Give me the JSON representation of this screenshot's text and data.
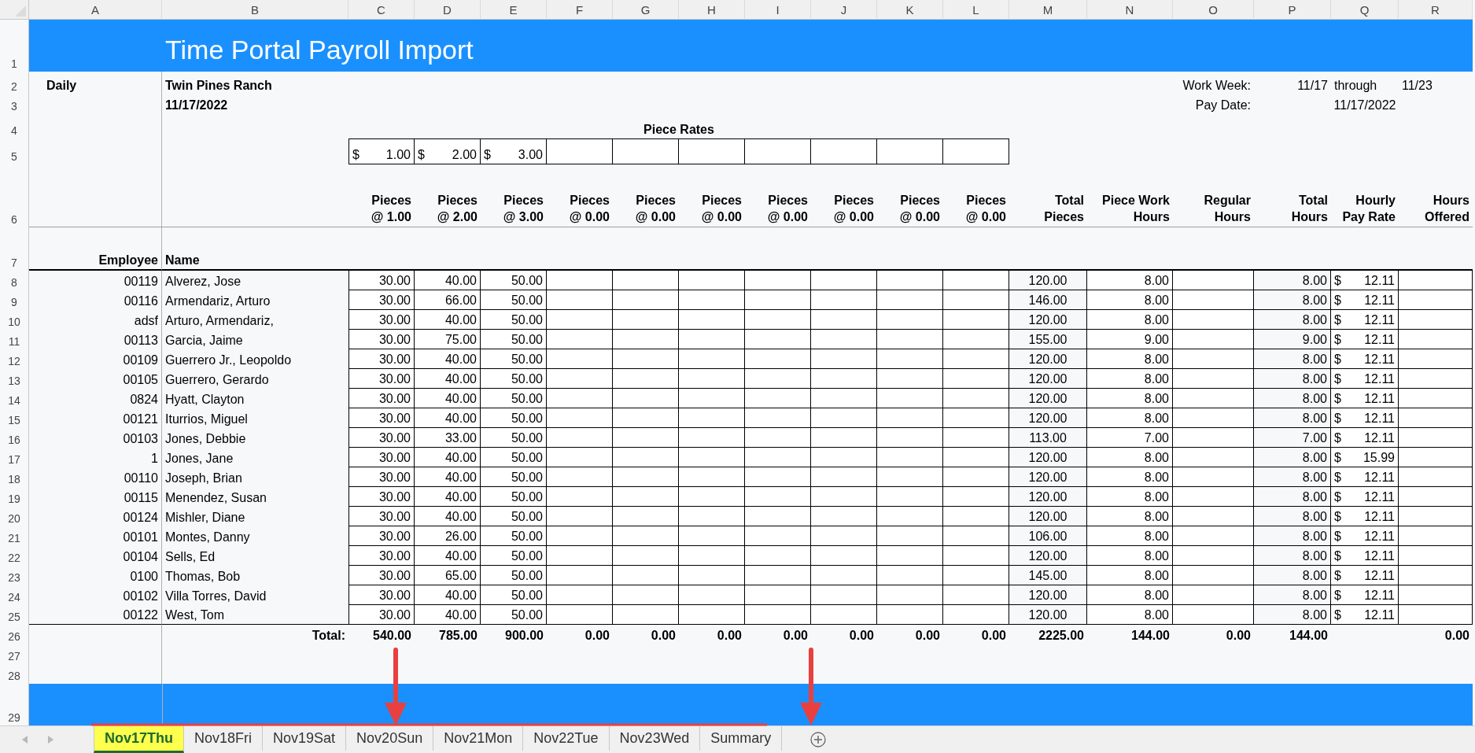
{
  "column_letters": [
    "A",
    "B",
    "C",
    "D",
    "E",
    "F",
    "G",
    "H",
    "I",
    "J",
    "K",
    "L",
    "M",
    "N",
    "O",
    "P",
    "Q",
    "R"
  ],
  "row_numbers": [
    "1",
    "2",
    "3",
    "4",
    "5",
    "6",
    "7",
    "8",
    "9",
    "10",
    "11",
    "12",
    "13",
    "14",
    "15",
    "16",
    "17",
    "18",
    "19",
    "20",
    "21",
    "22",
    "23",
    "24",
    "25",
    "26",
    "27",
    "28",
    "29"
  ],
  "title": "Time Portal Payroll Import",
  "report_type": "Daily",
  "company": "Twin Pines Ranch",
  "report_date": "11/17/2022",
  "work_week": {
    "label": "Work Week:",
    "start": "11/17",
    "through": "through",
    "end": "11/23"
  },
  "pay_date": {
    "label": "Pay Date:",
    "value": "11/17/2022"
  },
  "piece_rates": {
    "title": "Piece Rates",
    "rates": [
      {
        "currency": "$",
        "amount": "1.00"
      },
      {
        "currency": "$",
        "amount": "2.00"
      },
      {
        "currency": "$",
        "amount": "3.00"
      }
    ]
  },
  "column_headings": [
    {
      "lines": [
        "Pieces",
        "@ 1.00"
      ]
    },
    {
      "lines": [
        "Pieces",
        "@ 2.00"
      ]
    },
    {
      "lines": [
        "Pieces",
        "@ 3.00"
      ]
    },
    {
      "lines": [
        "Pieces",
        "@ 0.00"
      ]
    },
    {
      "lines": [
        "Pieces",
        "@ 0.00"
      ]
    },
    {
      "lines": [
        "Pieces",
        "@ 0.00"
      ]
    },
    {
      "lines": [
        "Pieces",
        "@ 0.00"
      ]
    },
    {
      "lines": [
        "Pieces",
        "@ 0.00"
      ]
    },
    {
      "lines": [
        "Pieces",
        "@ 0.00"
      ]
    },
    {
      "lines": [
        "Pieces",
        "@ 0.00"
      ]
    },
    {
      "lines": [
        "Total",
        "Pieces"
      ]
    },
    {
      "lines": [
        "Piece Work",
        "Hours"
      ]
    },
    {
      "lines": [
        "Regular",
        "Hours"
      ]
    },
    {
      "lines": [
        "Total",
        "Hours"
      ]
    },
    {
      "lines": [
        "Hourly",
        "Pay Rate"
      ]
    },
    {
      "lines": [
        "Hours",
        "Offered"
      ]
    }
  ],
  "employee_heading": "Employee",
  "name_heading": "Name",
  "rows": [
    {
      "employee": "00119",
      "name": "Alverez, Jose",
      "pieces": [
        "30.00",
        "40.00",
        "50.00"
      ],
      "total_pieces": "120.00",
      "piece_work_hours": "8.00",
      "total_hours": "8.00",
      "pay_rate": {
        "currency": "$",
        "amount": "12.11"
      }
    },
    {
      "employee": "00116",
      "name": "Armendariz, Arturo",
      "pieces": [
        "30.00",
        "66.00",
        "50.00"
      ],
      "total_pieces": "146.00",
      "piece_work_hours": "8.00",
      "total_hours": "8.00",
      "pay_rate": {
        "currency": "$",
        "amount": "12.11"
      }
    },
    {
      "employee": "adsf",
      "name": "Arturo, Armendariz,",
      "pieces": [
        "30.00",
        "40.00",
        "50.00"
      ],
      "total_pieces": "120.00",
      "piece_work_hours": "8.00",
      "total_hours": "8.00",
      "pay_rate": {
        "currency": "$",
        "amount": "12.11"
      }
    },
    {
      "employee": "00113",
      "name": "Garcia, Jaime",
      "pieces": [
        "30.00",
        "75.00",
        "50.00"
      ],
      "total_pieces": "155.00",
      "piece_work_hours": "9.00",
      "total_hours": "9.00",
      "pay_rate": {
        "currency": "$",
        "amount": "12.11"
      }
    },
    {
      "employee": "00109",
      "name": "Guerrero Jr., Leopoldo",
      "pieces": [
        "30.00",
        "40.00",
        "50.00"
      ],
      "total_pieces": "120.00",
      "piece_work_hours": "8.00",
      "total_hours": "8.00",
      "pay_rate": {
        "currency": "$",
        "amount": "12.11"
      }
    },
    {
      "employee": "00105",
      "name": "Guerrero, Gerardo",
      "pieces": [
        "30.00",
        "40.00",
        "50.00"
      ],
      "total_pieces": "120.00",
      "piece_work_hours": "8.00",
      "total_hours": "8.00",
      "pay_rate": {
        "currency": "$",
        "amount": "12.11"
      }
    },
    {
      "employee": "0824",
      "name": "Hyatt, Clayton",
      "pieces": [
        "30.00",
        "40.00",
        "50.00"
      ],
      "total_pieces": "120.00",
      "piece_work_hours": "8.00",
      "total_hours": "8.00",
      "pay_rate": {
        "currency": "$",
        "amount": "12.11"
      }
    },
    {
      "employee": "00121",
      "name": "Iturrios, Miguel",
      "pieces": [
        "30.00",
        "40.00",
        "50.00"
      ],
      "total_pieces": "120.00",
      "piece_work_hours": "8.00",
      "total_hours": "8.00",
      "pay_rate": {
        "currency": "$",
        "amount": "12.11"
      }
    },
    {
      "employee": "00103",
      "name": "Jones, Debbie",
      "pieces": [
        "30.00",
        "33.00",
        "50.00"
      ],
      "total_pieces": "113.00",
      "piece_work_hours": "7.00",
      "total_hours": "7.00",
      "pay_rate": {
        "currency": "$",
        "amount": "12.11"
      }
    },
    {
      "employee": "1",
      "name": "Jones, Jane",
      "pieces": [
        "30.00",
        "40.00",
        "50.00"
      ],
      "total_pieces": "120.00",
      "piece_work_hours": "8.00",
      "total_hours": "8.00",
      "pay_rate": {
        "currency": "$",
        "amount": "15.99"
      }
    },
    {
      "employee": "00110",
      "name": "Joseph, Brian",
      "pieces": [
        "30.00",
        "40.00",
        "50.00"
      ],
      "total_pieces": "120.00",
      "piece_work_hours": "8.00",
      "total_hours": "8.00",
      "pay_rate": {
        "currency": "$",
        "amount": "12.11"
      }
    },
    {
      "employee": "00115",
      "name": "Menendez, Susan",
      "pieces": [
        "30.00",
        "40.00",
        "50.00"
      ],
      "total_pieces": "120.00",
      "piece_work_hours": "8.00",
      "total_hours": "8.00",
      "pay_rate": {
        "currency": "$",
        "amount": "12.11"
      }
    },
    {
      "employee": "00124",
      "name": "Mishler, Diane",
      "pieces": [
        "30.00",
        "40.00",
        "50.00"
      ],
      "total_pieces": "120.00",
      "piece_work_hours": "8.00",
      "total_hours": "8.00",
      "pay_rate": {
        "currency": "$",
        "amount": "12.11"
      }
    },
    {
      "employee": "00101",
      "name": "Montes, Danny",
      "pieces": [
        "30.00",
        "26.00",
        "50.00"
      ],
      "total_pieces": "106.00",
      "piece_work_hours": "8.00",
      "total_hours": "8.00",
      "pay_rate": {
        "currency": "$",
        "amount": "12.11"
      }
    },
    {
      "employee": "00104",
      "name": "Sells, Ed",
      "pieces": [
        "30.00",
        "40.00",
        "50.00"
      ],
      "total_pieces": "120.00",
      "piece_work_hours": "8.00",
      "total_hours": "8.00",
      "pay_rate": {
        "currency": "$",
        "amount": "12.11"
      }
    },
    {
      "employee": "0100",
      "name": "Thomas, Bob",
      "pieces": [
        "30.00",
        "65.00",
        "50.00"
      ],
      "total_pieces": "145.00",
      "piece_work_hours": "8.00",
      "total_hours": "8.00",
      "pay_rate": {
        "currency": "$",
        "amount": "12.11"
      }
    },
    {
      "employee": "00102",
      "name": "Villa Torres, David",
      "pieces": [
        "30.00",
        "40.00",
        "50.00"
      ],
      "total_pieces": "120.00",
      "piece_work_hours": "8.00",
      "total_hours": "8.00",
      "pay_rate": {
        "currency": "$",
        "amount": "12.11"
      }
    },
    {
      "employee": "00122",
      "name": "West, Tom",
      "pieces": [
        "30.00",
        "40.00",
        "50.00"
      ],
      "total_pieces": "120.00",
      "piece_work_hours": "8.00",
      "total_hours": "8.00",
      "pay_rate": {
        "currency": "$",
        "amount": "12.11"
      }
    }
  ],
  "totals": {
    "label": "Total:",
    "pieces": [
      "540.00",
      "785.00",
      "900.00",
      "0.00",
      "0.00",
      "0.00",
      "0.00",
      "0.00",
      "0.00",
      "0.00"
    ],
    "total_pieces": "2225.00",
    "piece_work_hours": "144.00",
    "regular_hours": "0.00",
    "total_hours": "144.00",
    "hours_offered": "0.00"
  },
  "sheet_tabs": [
    {
      "label": "Nov17Thu",
      "selected": true
    },
    {
      "label": "Nov18Fri",
      "selected": false
    },
    {
      "label": "Nov19Sat",
      "selected": false
    },
    {
      "label": "Nov20Sun",
      "selected": false
    },
    {
      "label": "Nov21Mon",
      "selected": false
    },
    {
      "label": "Nov22Tue",
      "selected": false
    },
    {
      "label": "Nov23Wed",
      "selected": false
    },
    {
      "label": "Summary",
      "selected": false
    }
  ]
}
